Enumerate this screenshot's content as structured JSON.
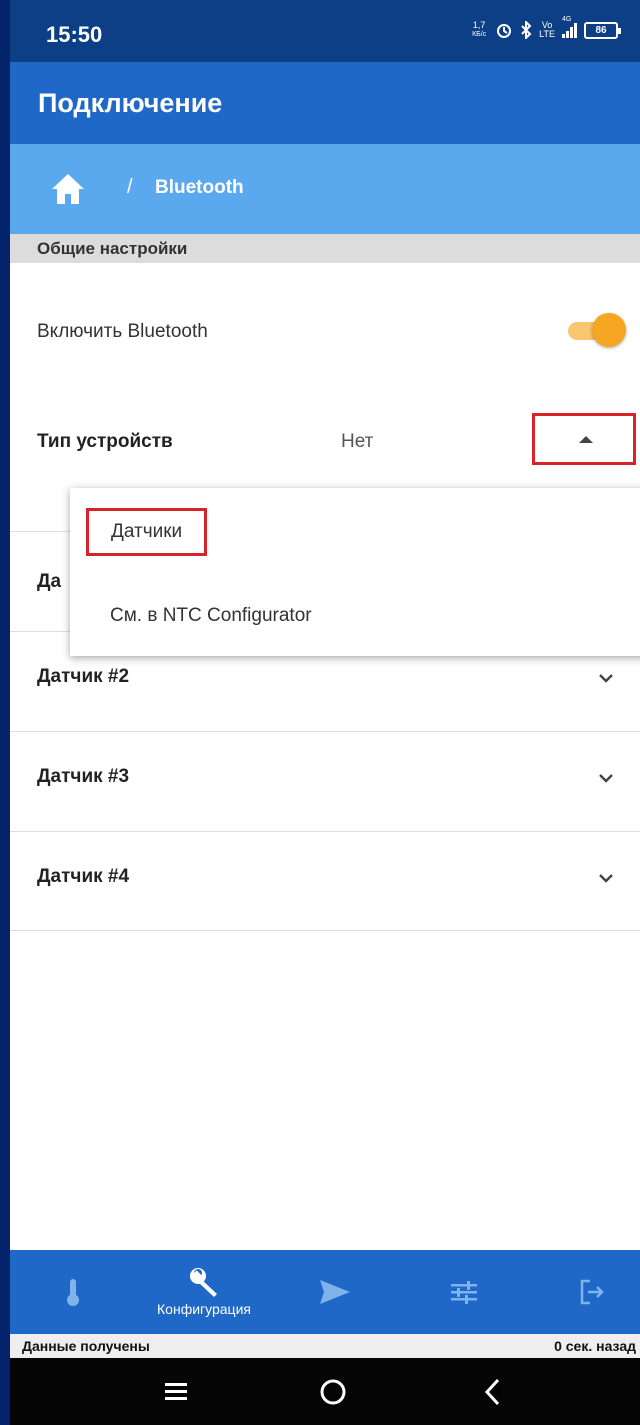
{
  "status_bar": {
    "time": "15:50",
    "net_speed_value": "1,7",
    "net_speed_unit": "КБ/с",
    "volte": "Vo",
    "lte": "LTE",
    "signal_tag": "4G",
    "battery": "86"
  },
  "app_bar": {
    "title": "Подключение"
  },
  "breadcrumb": {
    "separator": "/",
    "current": "Bluetooth"
  },
  "section": {
    "header": "Общие настройки"
  },
  "settings": {
    "bluetooth_label": "Включить Bluetooth",
    "bluetooth_enabled": true,
    "device_type_label": "Тип устройств",
    "device_type_value": "Нет"
  },
  "dropdown": {
    "options": [
      "Датчики",
      "См. в NTC Configurator"
    ],
    "highlighted_option": "Датчики"
  },
  "accordion": {
    "hidden_row_peek": "Да",
    "rows": [
      {
        "label": "Датчик #2"
      },
      {
        "label": "Датчик #3"
      },
      {
        "label": "Датчик #4"
      }
    ]
  },
  "bottom_nav": {
    "items": [
      {
        "icon": "thermometer-icon"
      },
      {
        "icon": "wrench-icon",
        "label": "Конфигурация",
        "active": true
      },
      {
        "icon": "send-icon"
      },
      {
        "icon": "sliders-icon"
      },
      {
        "icon": "logout-icon"
      }
    ]
  },
  "data_status": {
    "left": "Данные получены",
    "right": "0 сек. назад"
  },
  "colors": {
    "app_bar": "#1f68c7",
    "breadcrumb": "#5aa9ef",
    "toggle": "#f5a623",
    "highlight_border": "#d9232a"
  }
}
